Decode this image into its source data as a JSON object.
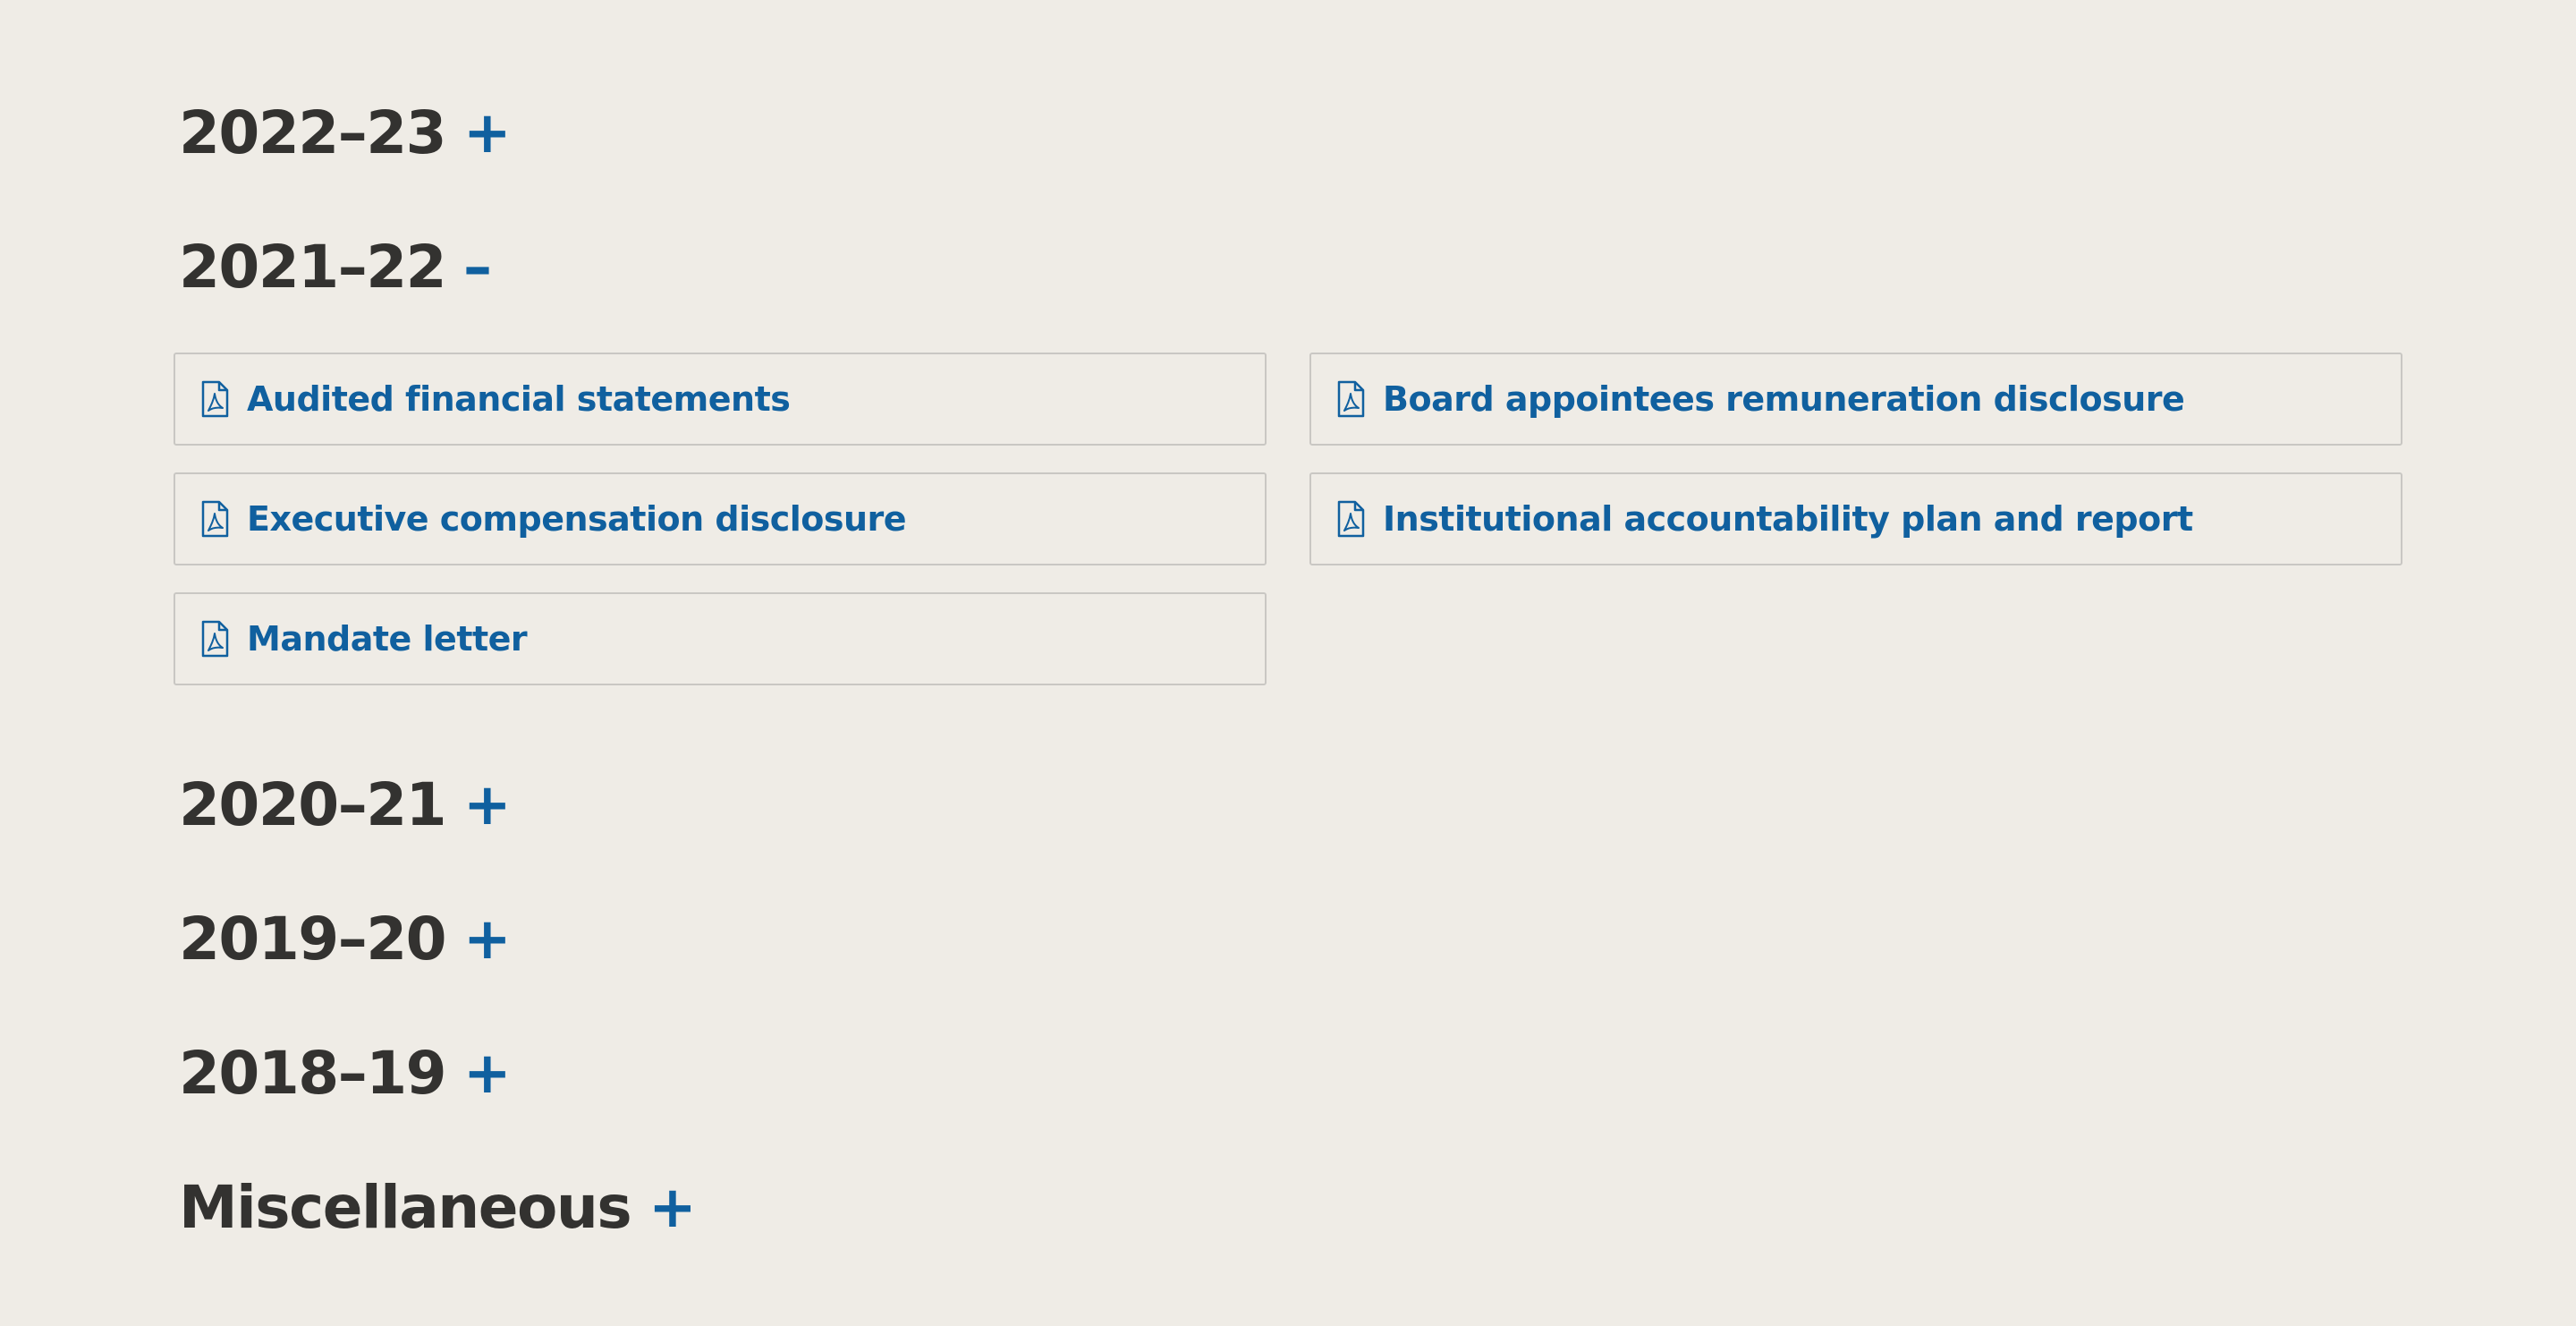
{
  "sections": [
    {
      "title": "2022–23",
      "toggle": "+"
    },
    {
      "title": "2021–22",
      "toggle": "–"
    },
    {
      "title": "2020–21",
      "toggle": "+"
    },
    {
      "title": "2019–20",
      "toggle": "+"
    },
    {
      "title": "2018–19",
      "toggle": "+"
    },
    {
      "title": "Miscellaneous",
      "toggle": "+"
    }
  ],
  "documents_2021_22": [
    {
      "label": "Audited financial statements",
      "icon": "pdf-icon"
    },
    {
      "label": "Board appointees remuneration disclosure",
      "icon": "pdf-icon"
    },
    {
      "label": "Executive compensation disclosure",
      "icon": "pdf-icon"
    },
    {
      "label": "Institutional accountability plan and report",
      "icon": "pdf-icon"
    },
    {
      "label": "Mandate letter",
      "icon": "pdf-icon"
    }
  ],
  "colors": {
    "background": "#efece6",
    "heading": "#333230",
    "accent": "#10609f",
    "border": "#c9c7c3"
  }
}
